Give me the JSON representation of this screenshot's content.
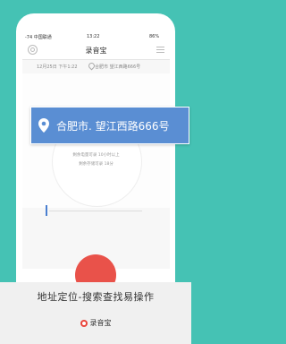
{
  "status_bar": {
    "carrier": "-74 中国联通",
    "time": "13:22",
    "battery": "86%"
  },
  "nav": {
    "title": "录音宝"
  },
  "info": {
    "date": "12月25日  下午1:22",
    "location": "合肥市 望江西路666号"
  },
  "stats": {
    "battery_line": "剩余电量可录 10小时以上",
    "storage_line": "剩余存储可录 18分"
  },
  "callout": {
    "text": "合肥市. 望江西路666号"
  },
  "caption": {
    "text": "地址定位-搜索查找易操作",
    "brand": "录音宝"
  },
  "colors": {
    "background": "#45c2b4",
    "callout": "#5a8ed3",
    "record": "#e9524a"
  }
}
